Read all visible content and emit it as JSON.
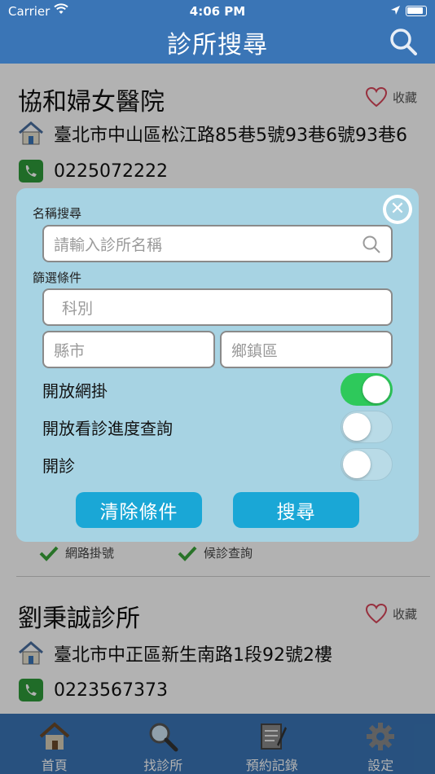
{
  "status": {
    "carrier": "Carrier",
    "time": "4:06 PM"
  },
  "nav": {
    "title": "診所搜尋",
    "search_icon": "search-icon"
  },
  "clinics": [
    {
      "name": "協和婦女醫院",
      "fav_label": "收藏",
      "address": "臺北市中山區松江路85巷5號93巷6號93巷6",
      "phone": "0225072222"
    },
    {
      "name": "劉秉誠診所",
      "fav_label": "收藏",
      "address": "臺北市中正區新生南路1段92號2樓",
      "phone": "0223567373"
    }
  ],
  "tags": [
    "網路掛號",
    "候診查詢"
  ],
  "dialog": {
    "name_search_label": "名稱搜尋",
    "name_placeholder": "請輸入診所名稱",
    "filter_label": "篩選條件",
    "department_placeholder": "科別",
    "county_placeholder": "縣市",
    "district_placeholder": "鄉鎮區",
    "switches": [
      {
        "label": "開放網掛",
        "on": true
      },
      {
        "label": "開放看診進度查詢",
        "on": false
      },
      {
        "label": "開診",
        "on": false
      }
    ],
    "clear_button": "清除條件",
    "search_button": "搜尋"
  },
  "tabs": [
    {
      "label": "首頁",
      "icon": "home-icon"
    },
    {
      "label": "找診所",
      "icon": "magnifier-icon"
    },
    {
      "label": "預約記錄",
      "icon": "notepad-icon"
    },
    {
      "label": "設定",
      "icon": "gear-icon"
    }
  ],
  "colors": {
    "nav": "#3a75b6",
    "dialog": "#a7d3e3",
    "button": "#1aa7d6",
    "switch_on": "#2ec95b"
  }
}
